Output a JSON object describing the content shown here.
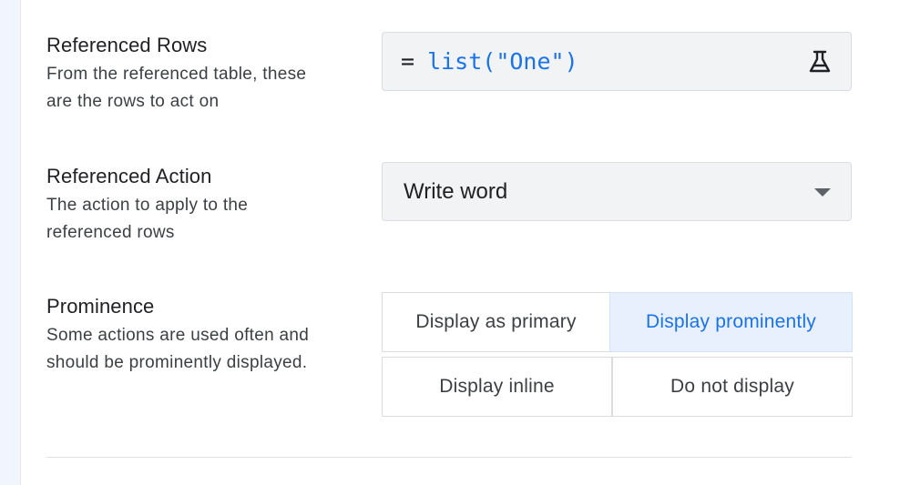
{
  "referenced_rows": {
    "title": "Referenced Rows",
    "description_line1": "From the referenced table, these",
    "description_line2": "are the rows to act on",
    "formula_prefix": "=",
    "formula_value": "list(\"One\")",
    "test_icon": "flask-icon"
  },
  "referenced_action": {
    "title": "Referenced Action",
    "description_line1": "The action to apply to the",
    "description_line2": "referenced rows",
    "selected_value": "Write word",
    "dropdown_icon": "chevron-down-icon"
  },
  "prominence": {
    "title": "Prominence",
    "description_line1": "Some actions are used often and",
    "description_line2": "should be prominently displayed.",
    "options": [
      {
        "label": "Display as primary",
        "selected": false
      },
      {
        "label": "Display prominently",
        "selected": true
      },
      {
        "label": "Display inline",
        "selected": false
      },
      {
        "label": "Do not display",
        "selected": false
      }
    ]
  },
  "colors": {
    "accent": "#1a73e8",
    "selected_bg": "#e8f0fe",
    "field_bg": "#f1f3f4"
  }
}
